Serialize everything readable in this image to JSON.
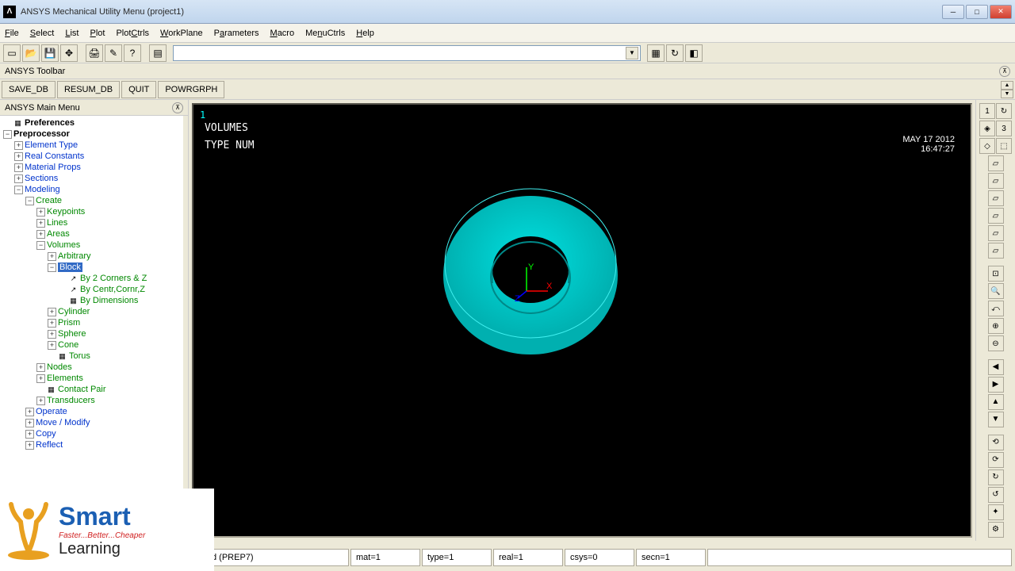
{
  "titlebar": {
    "text": "ANSYS Mechanical Utility Menu (project1)",
    "app_icon": "Λ"
  },
  "menubar": [
    "File",
    "Select",
    "List",
    "Plot",
    "PlotCtrls",
    "WorkPlane",
    "Parameters",
    "Macro",
    "MenuCtrls",
    "Help"
  ],
  "toolbar_section": "ANSYS Toolbar",
  "toolbar_buttons": [
    "SAVE_DB",
    "RESUM_DB",
    "QUIT",
    "POWRGRPH"
  ],
  "sidebar_title": "ANSYS Main Menu",
  "tree": {
    "preferences": "Preferences",
    "preprocessor": "Preprocessor",
    "element_type": "Element Type",
    "real_constants": "Real Constants",
    "material_props": "Material Props",
    "sections": "Sections",
    "modeling": "Modeling",
    "create": "Create",
    "keypoints": "Keypoints",
    "lines": "Lines",
    "areas": "Areas",
    "volumes": "Volumes",
    "arbitrary": "Arbitrary",
    "block": "Block",
    "by2corners": "By 2 Corners & Z",
    "bycentrcornz": "By Centr,Cornr,Z",
    "bydimensions": "By Dimensions",
    "cylinder": "Cylinder",
    "prism": "Prism",
    "sphere": "Sphere",
    "cone": "Cone",
    "torus": "Torus",
    "nodes": "Nodes",
    "elements": "Elements",
    "contact_pair": "Contact Pair",
    "transducers": "Transducers",
    "operate": "Operate",
    "move_modify": "Move / Modify",
    "copy": "Copy",
    "reflect": "Reflect"
  },
  "canvas": {
    "num": "1",
    "volumes": "VOLUMES",
    "typenum": "TYPE NUM",
    "date": "MAY 17 2012",
    "time": "16:47:27"
  },
  "status": {
    "prep": "d (PREP7)",
    "mat": "mat=1",
    "type": "type=1",
    "real": "real=1",
    "csys": "csys=0",
    "secn": "secn=1"
  },
  "right_combo": [
    "1",
    "3"
  ],
  "logo": {
    "brand": "Smart",
    "tag": "Faster...Better...Cheaper",
    "sub": "Learning"
  }
}
